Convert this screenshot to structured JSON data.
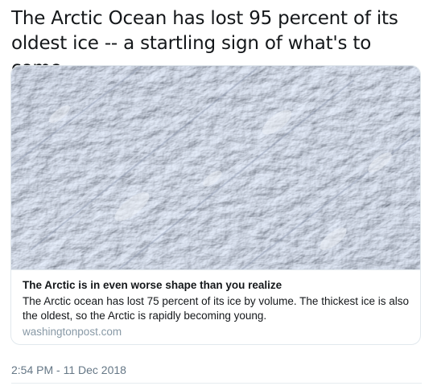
{
  "tweet": {
    "text": "The Arctic Ocean has lost 95 percent of its oldest ice -- a startling sign of what's to come",
    "timestamp": "2:54 PM - 11 Dec 2018"
  },
  "card": {
    "image_alt_icon": "sea-ice-aerial-photo",
    "title": "The Arctic is in even worse shape than you realize",
    "description": "The Arctic ocean has lost 75 percent of its ice by volume. The thickest ice is also the oldest, so the Arctic is rapidly becoming young.",
    "domain": "washingtonpost.com"
  },
  "colors": {
    "text_primary": "#14171a",
    "text_secondary": "#657786",
    "domain_gray": "#8899a6",
    "card_border": "#e1e8ed",
    "ice_base": "#b9c3d6"
  }
}
